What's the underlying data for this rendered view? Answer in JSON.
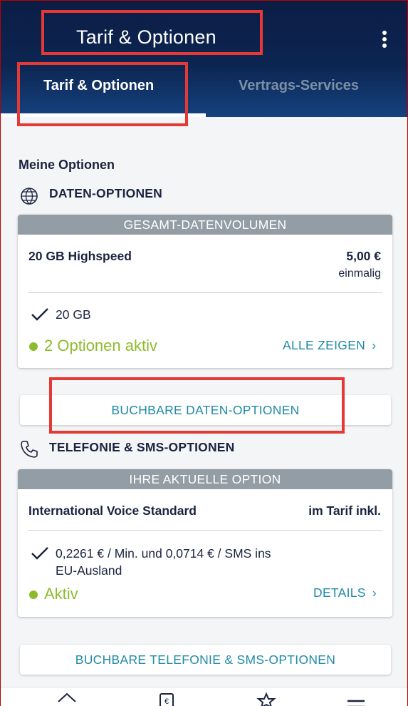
{
  "header": {
    "title": "Tarif & Optionen",
    "menu_icon": "kebab-menu-icon"
  },
  "tabs": [
    {
      "label": "Tarif & Optionen",
      "active": true
    },
    {
      "label": "Vertrags-Services",
      "active": false
    }
  ],
  "section": {
    "title": "Meine Optionen"
  },
  "data_options": {
    "heading": "DATEN-OPTIONEN",
    "icon": "globe-icon",
    "card_header": "GESAMT-DATENVOLUMEN",
    "name": "20 GB Highspeed",
    "price": "5,00 €",
    "price_note": "einmalig",
    "feature": "20 GB",
    "status": "2 Optionen aktiv",
    "link": "ALLE ZEIGEN",
    "book_button": "BUCHBARE DATEN-OPTIONEN"
  },
  "telephony_options": {
    "heading": "TELEFONIE & SMS-OPTIONEN",
    "icon": "phone-icon",
    "card_header": "IHRE AKTUELLE OPTION",
    "name": "International Voice Standard",
    "price": "im Tarif inkl.",
    "feature_line1": "0,2261 € / Min. und 0,0714 € / SMS ins",
    "feature_line2": "EU-Ausland",
    "status": "Aktiv",
    "link": "DETAILS",
    "book_button": "BUCHBARE TELEFONIE & SMS-OPTIONEN"
  },
  "bottom_nav": [
    "home-icon",
    "bill-icon",
    "star-icon",
    "menu-icon"
  ],
  "colors": {
    "header_dark": "#0b1d45",
    "accent_teal": "#1f8aa7",
    "status_green": "#8dbb2c",
    "card_header_grey": "#939da5",
    "annotation_red": "#e53935"
  }
}
